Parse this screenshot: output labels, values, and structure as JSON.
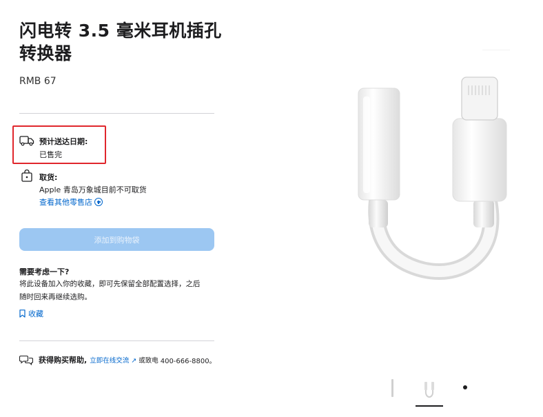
{
  "product": {
    "title": "闪电转 3.5 毫米耳机插孔转换器",
    "price": "RMB 67"
  },
  "delivery": {
    "label": "预计送达日期:",
    "status": "已售完",
    "icon": "truck-icon"
  },
  "pickup": {
    "label": "取货:",
    "store": "Apple 青岛万象城目前不可取货",
    "link": "查看其他零售店",
    "icon": "shopping-bag-icon"
  },
  "cart": {
    "add_label": "添加到购物袋",
    "button_color": "#9cc7f2"
  },
  "save": {
    "title": "需要考虑一下?",
    "body_line1": "将此设备加入你的收藏，即可先保留全部配置选择，之后",
    "body_line2": "随时回来再继续选购。",
    "link": "收藏",
    "icon": "bookmark-icon"
  },
  "help": {
    "label": "获得购买帮助,",
    "chat_link": "立即在线交流",
    "call_text": "或致电",
    "phone": "400-666-8800。",
    "icon": "chat-bubbles-icon"
  },
  "gallery": {
    "thumbnails": [
      "adapter-side-thumbnail",
      "adapter-front-thumbnail",
      "dot-thumbnail"
    ],
    "selected_index": 1
  },
  "colors": {
    "accent": "#0066cc",
    "highlight": "#e0262c",
    "text": "#1d1d1f"
  }
}
